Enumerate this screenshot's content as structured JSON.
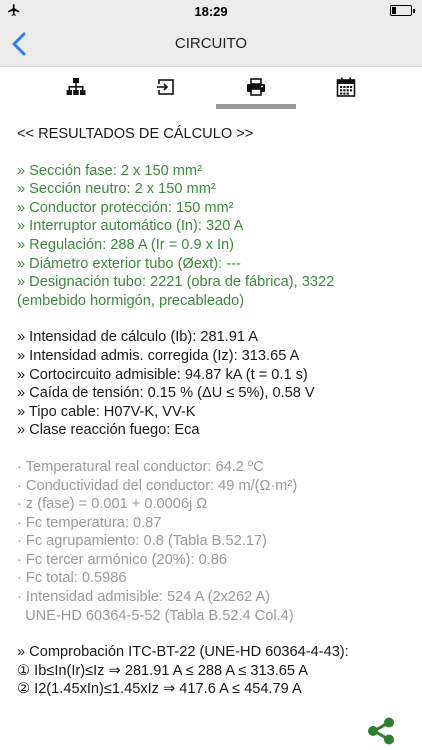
{
  "status_bar": {
    "time": "18:29",
    "icons": [
      "airplane-icon",
      "battery-icon"
    ]
  },
  "nav": {
    "title": "CIRCUITO",
    "back_icon": "chevron-left-icon"
  },
  "tabs": [
    {
      "icon": "hierarchy-icon",
      "active": false
    },
    {
      "icon": "export-icon",
      "active": false
    },
    {
      "icon": "printer-icon",
      "active": true
    },
    {
      "icon": "calendar-icon",
      "active": false
    }
  ],
  "results": {
    "heading": "<< RESULTADOS DE CÁLCULO >>",
    "group1": [
      "» Sección fase: 2 x 150 mm²",
      "» Sección neutro: 2 x 150 mm²",
      "» Conductor protección: 150 mm²",
      "» Interruptor automático (In): 320 A",
      "» Regulación: 288 A (Ir = 0.9 x In)",
      "» Diámetro exterior tubo (Øext): ---",
      "» Designación tubo: 2221 (obra de fábrica), 3322",
      "(embebido hormigón, precableado)"
    ],
    "group2": [
      "» Intensidad de cálculo (Ib): 281.91 A",
      "» Intensidad admis. corregida (Iz): 313.65 A",
      "» Cortocircuito admisible: 94.87 kA (t = 0.1 s)",
      "» Caída de tensión: 0.15 % (ΔU ≤ 5%), 0.58 V",
      "» Tipo cable: H07V-K, VV-K",
      "» Clase reacción fuego: Eca"
    ],
    "group3": [
      "· Temperatural real conductor: 64.2 ºC",
      "· Conductividad del conductor: 49 m/(Ω·m²)",
      "· z (fase) = 0.001 + 0.0006j Ω",
      "· Fc temperatura: 0.87",
      "· Fc agrupamiento: 0.8 (Tabla B.52.17)",
      "· Fc tercer armónico (20%): 0.86",
      "· Fc total: 0.5986",
      "· Intensidad admisible: 524 A (2x262 A)",
      "  UNE-HD 60364-5-52 (Tabla B.52.4 Col.4)"
    ],
    "group4": [
      "» Comprobación ITC-BT-22 (UNE-HD 60364-4-43):",
      "① Ib≤In(Ir)≤Iz ⇒ 281.91 A ≤ 288 A ≤ 313.65 A",
      "② I2(1.45xIn)≤1.45xIz ⇒ 417.6 A ≤ 454.79 A"
    ]
  },
  "colors": {
    "bar_bg": "#ececec",
    "accent_blue": "#2f7cf6",
    "green_text": "#3d8a3d",
    "gray_text": "#9a9a9a",
    "share_green": "#2e7d32"
  },
  "share_icon": "share-icon"
}
